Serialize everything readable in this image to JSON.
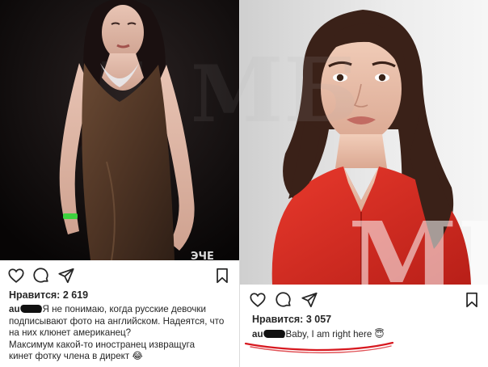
{
  "posts": [
    {
      "likes_label": "Нравится: 2 619",
      "username_visible": "au",
      "caption_lines": [
        "Я не понимаю, когда русские девочки",
        "подписывают фото на английском. Надеятся, что",
        "на них клюнет американец?",
        "Максимум какой-то иностранец извращуга",
        "кинет фотку члена в директ 😂"
      ],
      "watermark": "МБ",
      "overlay_text": "ЭЧЕ"
    },
    {
      "likes_label": "Нравится: 3 057",
      "username_visible": "au",
      "caption": "Baby, I am right here 😇",
      "watermark_top": "МБ",
      "watermark_bottom": "МБ"
    }
  ],
  "icons": [
    "heart-icon",
    "comment-icon",
    "share-icon",
    "bookmark-icon"
  ],
  "colors": {
    "text": "#262626",
    "underline": "#d71920",
    "divider": "#dbdbdb"
  }
}
